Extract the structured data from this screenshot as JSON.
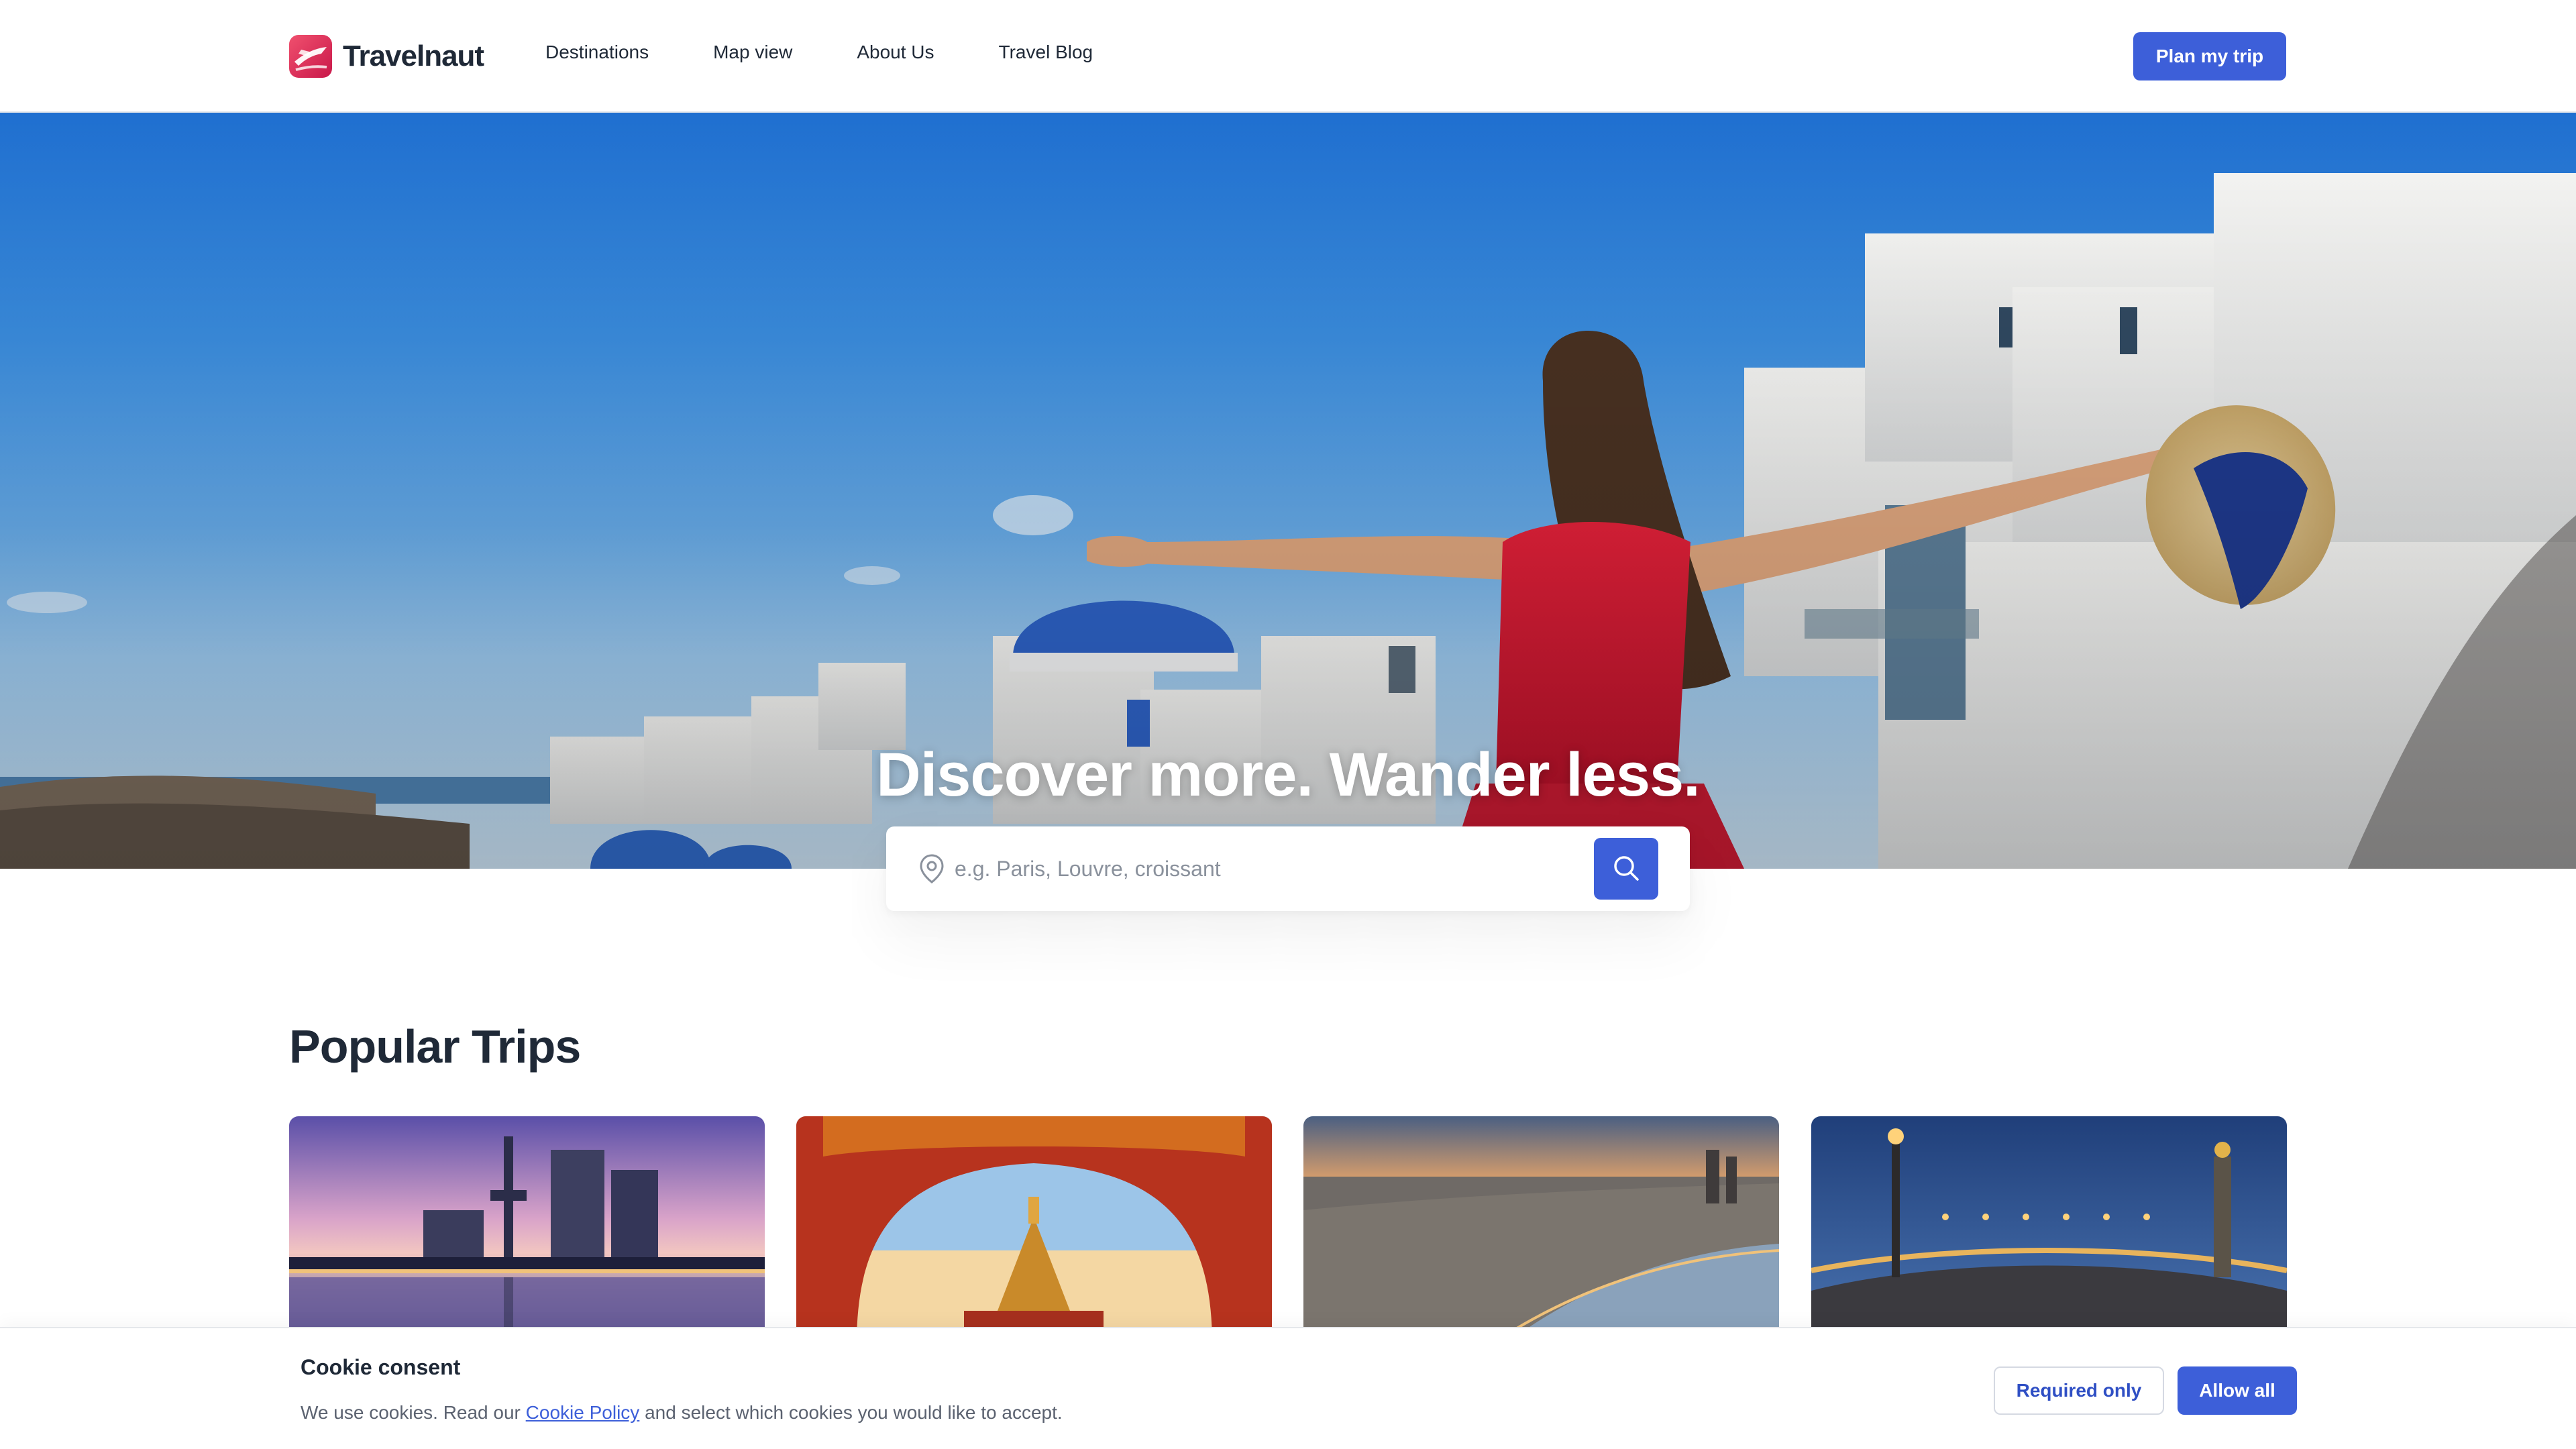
{
  "brand": {
    "name": "Travelnaut",
    "accent": "#3d5fd9",
    "logo_color": "#e0355f"
  },
  "nav": {
    "links": [
      "Destinations",
      "Map view",
      "About Us",
      "Travel Blog"
    ],
    "cta_label": "Plan my trip"
  },
  "hero": {
    "title": "Discover more. Wander less.",
    "image_description": null
  },
  "search": {
    "placeholder": "e.g. Paris, Louvre, croissant",
    "value": "",
    "icon_left": "map-pin-icon",
    "button_icon": "search-icon"
  },
  "popular": {
    "title": "Popular Trips",
    "cards": [
      {
        "scene": "tokyo-skyline-sunset"
      },
      {
        "scene": "bangkok-temple-arch"
      },
      {
        "scene": "barcelona-coast-dusk"
      },
      {
        "scene": "paris-bridge-night"
      }
    ]
  },
  "cookie": {
    "title": "Cookie consent",
    "text_before": "We use cookies. Read our ",
    "link_label": "Cookie Policy",
    "text_after": " and select which cookies you would like to accept.",
    "required_label": "Required only",
    "allow_label": "Allow all"
  }
}
